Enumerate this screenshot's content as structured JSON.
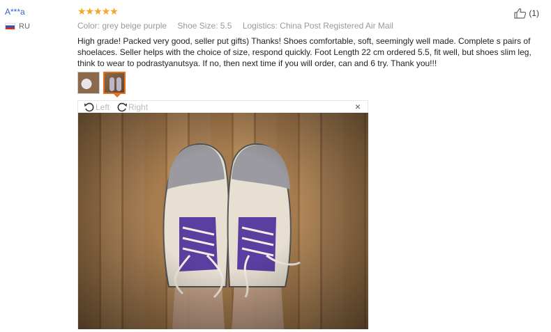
{
  "reviewer": {
    "name": "A***a",
    "country_code": "RU"
  },
  "review": {
    "stars": "★★★★★",
    "rating": 5,
    "color": "Color: grey beige purple",
    "size": "Shoe Size: 5.5",
    "logistics": "Logistics: China Post Registered Air Mail",
    "text": "High grade! Packed very good, seller put gifts) Thanks! Shoes comfortable, soft, seemingly well made. Complete s pairs of shoelaces. Seller helps with the choice of size, respond quickly. Foot Length 22 cm ordered 5.5, fit well, but shoes slim leg, think to wear to podrastyanutsya. If no, then next time if you will order, can and 6 try. Thank you!!!"
  },
  "helpful": {
    "count": "(1)"
  },
  "viewer": {
    "rotate_left": "Left",
    "rotate_right": "Right",
    "close": "×"
  },
  "colors": {
    "star": "#f5a623",
    "username": "#3366cc",
    "active_thumb": "#e8701a"
  }
}
